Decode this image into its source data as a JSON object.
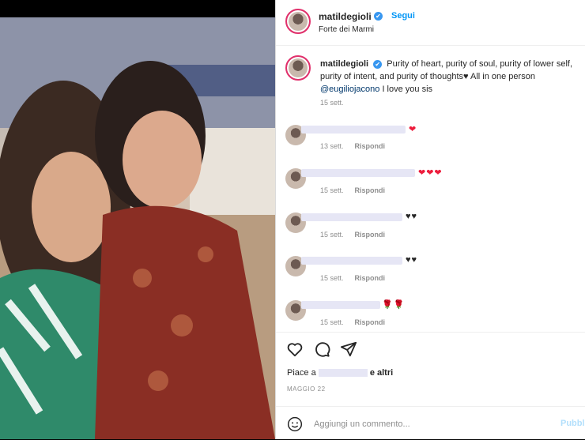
{
  "post": {
    "username": "matildegioli",
    "verified_mark": "✔",
    "follow_label": "Segui",
    "location": "Forte dei Marmi",
    "caption_prefix": "Purity of heart, purity of soul, purity of lower self, purity of intent, and purity of thoughts",
    "caption_heart": "♥",
    "caption_mid": " All in one person ",
    "caption_mention": "@eugiliojacono",
    "caption_suffix": " I love you sis",
    "caption_time": "15 sett."
  },
  "comments": [
    {
      "time": "13 sett.",
      "reply": "Rispondi",
      "emoji": "❤",
      "emoji_class": "red"
    },
    {
      "time": "15 sett.",
      "reply": "Rispondi",
      "emoji": "❤❤❤",
      "emoji_class": "red"
    },
    {
      "time": "15 sett.",
      "reply": "Rispondi",
      "emoji": "♥♥",
      "emoji_class": "blk"
    },
    {
      "time": "15 sett.",
      "reply": "Rispondi",
      "emoji": "♥♥",
      "emoji_class": "blk"
    },
    {
      "time": "15 sett.",
      "reply": "Rispondi",
      "emoji": "🌹🌹",
      "emoji_class": "rose"
    }
  ],
  "footer": {
    "likes_prefix": "Piace a",
    "likes_suffix": "e altri",
    "date": "MAGGIO 22",
    "comment_placeholder": "Aggiungi un commento...",
    "post_label": "Pubbl"
  },
  "icons": [
    "heart-icon",
    "comment-icon",
    "share-icon",
    "emoji-icon"
  ],
  "colors": {
    "accent": "#0095f6",
    "verified": "#3897f0",
    "heart": "#ed1c3c"
  }
}
